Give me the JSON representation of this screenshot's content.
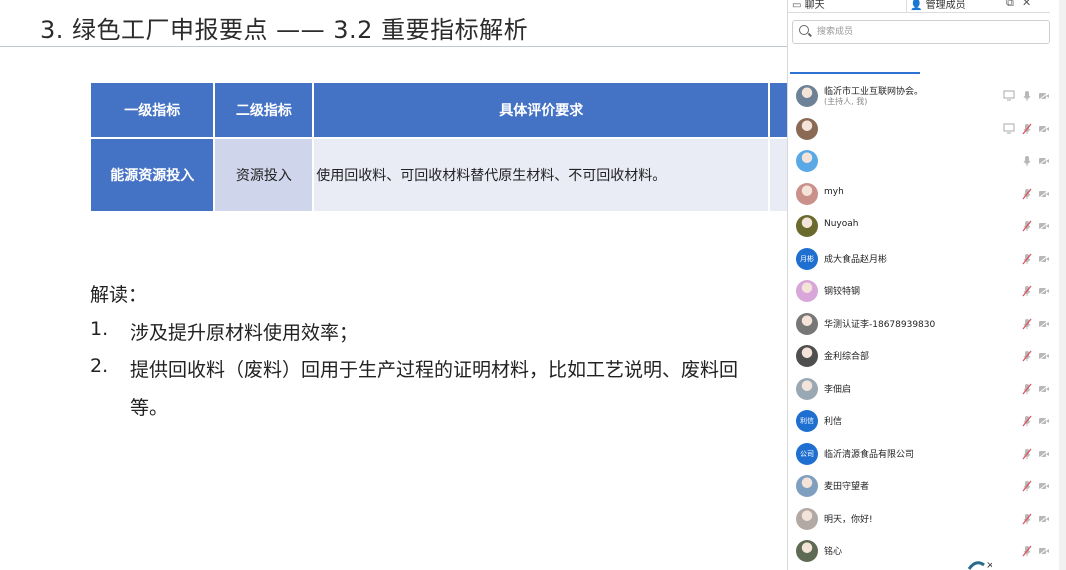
{
  "slide": {
    "title": "3. 绿色工厂申报要点 —— 3.2 重要指标解析",
    "table": {
      "headers": [
        "一级指标",
        "二级指标",
        "具体评价要求"
      ],
      "row": [
        "能源资源投入",
        "资源投入",
        "使用回收料、可回收材料替代原生材料、不可回收材料。"
      ]
    },
    "explanation_label": "解读：",
    "points": [
      {
        "num": "1.",
        "text": "涉及提升原材料使用效率；"
      },
      {
        "num": "2.",
        "text": "提供回收料（废料）回用于生产过程的证明材料，比如工艺说明、废料回"
      }
    ],
    "point2_cont": "等。"
  },
  "panel": {
    "tabs": {
      "chat": "聊天",
      "manage": "管理成员"
    },
    "search_placeholder": "搜索成员",
    "members": [
      {
        "name": "临沂市工业互联网协会。",
        "sub": "(主持人, 我)",
        "avatar": "photo",
        "av_color": "#6d8296",
        "mic": "on",
        "share": true
      },
      {
        "name": "",
        "avatar": "photo",
        "av_color": "#8a6a55",
        "mic": "off",
        "share": true
      },
      {
        "name": "",
        "avatar": "photo",
        "av_color": "#5aa9e6",
        "mic": "on"
      },
      {
        "name": "myh",
        "avatar": "photo",
        "av_color": "#c9918a",
        "mic": "off"
      },
      {
        "name": "Nuyoah",
        "avatar": "photo",
        "av_color": "#6b6a2e",
        "mic": "off"
      },
      {
        "name": "成大食品赵月彬",
        "avatar": "text",
        "avatar_text": "月彬",
        "mic": "off"
      },
      {
        "name": "钢铰特钢",
        "avatar": "photo",
        "av_color": "#d8a6d8",
        "mic": "off"
      },
      {
        "name": "华测认证李-18678939830",
        "avatar": "photo",
        "av_color": "#777777",
        "mic": "off"
      },
      {
        "name": "金利综合部",
        "avatar": "photo",
        "av_color": "#4f4f4f",
        "mic": "off"
      },
      {
        "name": "李佃启",
        "avatar": "photo",
        "av_color": "#9aa8b4",
        "mic": "off"
      },
      {
        "name": "利信",
        "avatar": "text",
        "avatar_text": "利信",
        "mic": "off"
      },
      {
        "name": "临沂清源食品有限公司",
        "avatar": "text",
        "avatar_text": "公司",
        "mic": "off"
      },
      {
        "name": "麦田守望者",
        "avatar": "photo",
        "av_color": "#7f9fc0",
        "mic": "off"
      },
      {
        "name": "明天，你好!",
        "avatar": "photo",
        "av_color": "#b3a9a4",
        "mic": "off"
      },
      {
        "name": "铭心",
        "avatar": "photo",
        "av_color": "#5e6a53",
        "mic": "off"
      }
    ]
  },
  "colors": {
    "accent": "#4472c4",
    "cell_mid": "#cfd5ea",
    "cell_light": "#e9ebf5",
    "mic_off": "#e0505a",
    "icon_gray": "#b8b8b8"
  }
}
